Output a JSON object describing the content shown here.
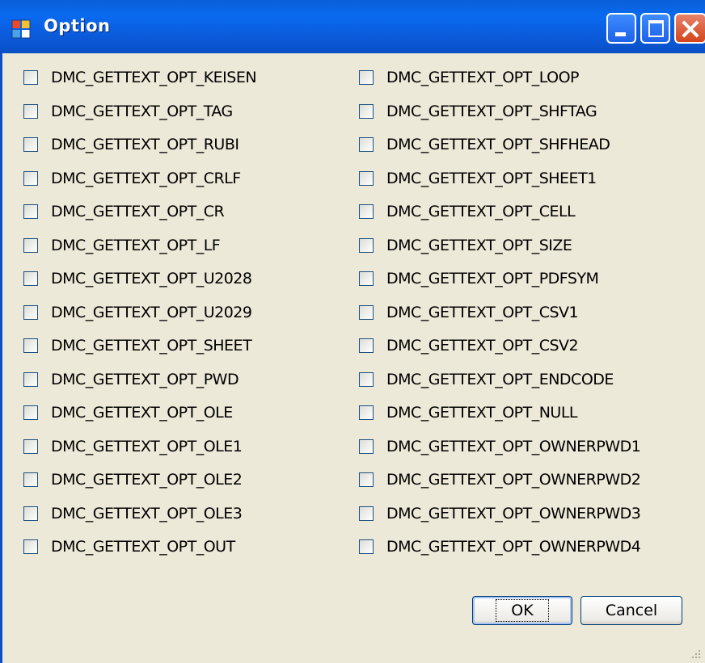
{
  "window": {
    "title": "Option"
  },
  "options": {
    "left": [
      "DMC_GETTEXT_OPT_KEISEN",
      "DMC_GETTEXT_OPT_TAG",
      "DMC_GETTEXT_OPT_RUBI",
      "DMC_GETTEXT_OPT_CRLF",
      "DMC_GETTEXT_OPT_CR",
      "DMC_GETTEXT_OPT_LF",
      "DMC_GETTEXT_OPT_U2028",
      "DMC_GETTEXT_OPT_U2029",
      "DMC_GETTEXT_OPT_SHEET",
      "DMC_GETTEXT_OPT_PWD",
      "DMC_GETTEXT_OPT_OLE",
      "DMC_GETTEXT_OPT_OLE1",
      "DMC_GETTEXT_OPT_OLE2",
      "DMC_GETTEXT_OPT_OLE3",
      "DMC_GETTEXT_OPT_OUT"
    ],
    "right": [
      "DMC_GETTEXT_OPT_LOOP",
      "DMC_GETTEXT_OPT_SHFTAG",
      "DMC_GETTEXT_OPT_SHFHEAD",
      "DMC_GETTEXT_OPT_SHEET1",
      "DMC_GETTEXT_OPT_CELL",
      "DMC_GETTEXT_OPT_SIZE",
      "DMC_GETTEXT_OPT_PDFSYM",
      "DMC_GETTEXT_OPT_CSV1",
      "DMC_GETTEXT_OPT_CSV2",
      "DMC_GETTEXT_OPT_ENDCODE",
      "DMC_GETTEXT_OPT_NULL",
      "DMC_GETTEXT_OPT_OWNERPWD1",
      "DMC_GETTEXT_OPT_OWNERPWD2",
      "DMC_GETTEXT_OPT_OWNERPWD3",
      "DMC_GETTEXT_OPT_OWNERPWD4"
    ]
  },
  "buttons": {
    "ok": "OK",
    "cancel": "Cancel"
  },
  "icons": {
    "app": "app-window-icon",
    "minimize": "minimize-icon",
    "maximize": "maximize-icon",
    "close": "close-icon",
    "grip": "resize-grip-icon"
  },
  "colors": {
    "titlebar": "#0a5fd8",
    "window_bg": "#ece9d8",
    "close_button": "#d3451c"
  }
}
